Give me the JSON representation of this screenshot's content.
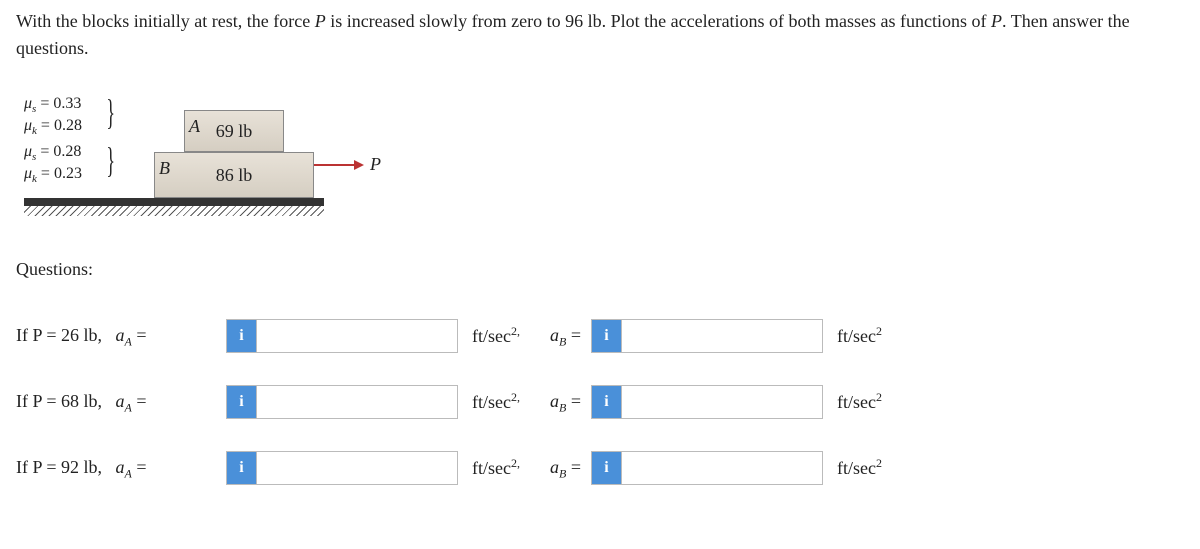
{
  "problem_text_1": "With the blocks initially at rest, the force ",
  "problem_text_P": "P",
  "problem_text_2": " is increased slowly from zero to 96 lb. Plot the accelerations of both masses as functions of ",
  "problem_text_3": ". Then answer the questions.",
  "diagram": {
    "block_a": {
      "label": "A",
      "weight": "69 lb"
    },
    "block_b": {
      "label": "B",
      "weight": "86 lb"
    },
    "mu_a": {
      "mus": "0.33",
      "muk": "0.28"
    },
    "mu_b": {
      "mus": "0.28",
      "muk": "0.23"
    },
    "force_label": "P"
  },
  "questions_heading": "Questions:",
  "rows": [
    {
      "p_label": "If P = 26 lb,"
    },
    {
      "p_label": "If P = 68 lb,"
    },
    {
      "p_label": "If P = 92 lb,"
    }
  ],
  "labels": {
    "aA_eq": "a",
    "aA_sub": "A",
    "aB_sub": "B",
    "equals": " = ",
    "unit_base": "ft/sec",
    "unit_sup_comma": "2,",
    "unit_sup": "2",
    "info": "i",
    "mus_label": "μ",
    "mus_sub": "s",
    "muk_sub": "k",
    "eq": " = "
  }
}
